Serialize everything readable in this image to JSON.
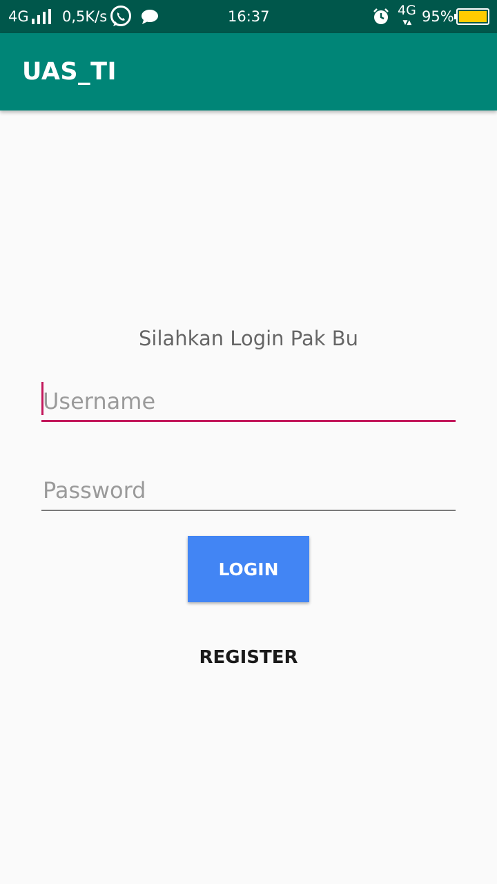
{
  "status_bar": {
    "network": "4G",
    "speed": "0,5K/s",
    "time": "16:37",
    "network_right": "4G",
    "battery": "95%",
    "icons": [
      "signal-icon",
      "whatsapp-icon",
      "message-icon",
      "alarm-icon",
      "battery-icon"
    ]
  },
  "app_bar": {
    "title": "UAS_TI"
  },
  "login": {
    "prompt": "Silahkan Login Pak Bu",
    "username_placeholder": "Username",
    "username_value": "",
    "password_placeholder": "Password",
    "password_value": "",
    "login_label": "LOGIN",
    "register_label": "REGISTER"
  },
  "colors": {
    "status_bar": "#00574b",
    "app_bar": "#008577",
    "accent": "#c2185b",
    "login_button": "#4285f4",
    "battery_fill": "#ffcc00"
  }
}
